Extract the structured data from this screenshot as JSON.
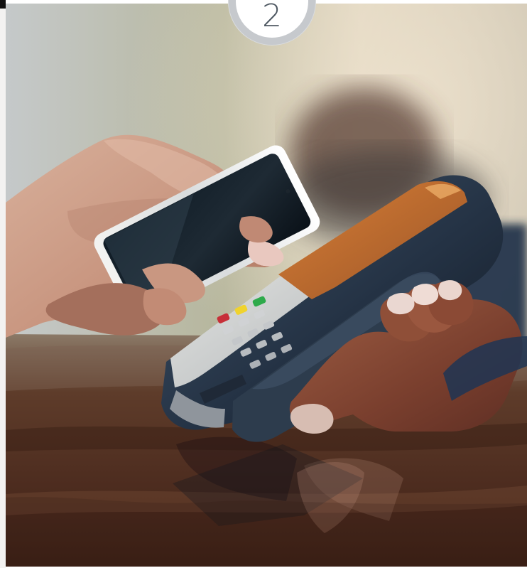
{
  "step_badge": {
    "number": "2"
  },
  "photo": {
    "subject": "contactless-phone-payment",
    "icons": [
      "smartphone",
      "payment-terminal",
      "hand"
    ]
  },
  "colors": {
    "badge_ring": "#c6c9cd",
    "badge_fill": "#ffffff",
    "badge_text": "#4c5660",
    "table_wood": "#5a3523",
    "background_blur": "#b7b39d",
    "terminal_orange": "#d8873b",
    "terminal_dark": "#253243"
  }
}
